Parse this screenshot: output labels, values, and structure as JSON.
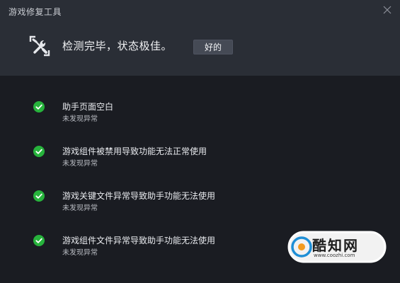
{
  "window": {
    "title": "游戏修复工具"
  },
  "header": {
    "status_text": "检测完毕，状态极佳。",
    "ok_button_label": "好的",
    "icon": "repair-tools-icon"
  },
  "results": [
    {
      "title": "助手页面空白",
      "status": "未发现异常",
      "icon": "check-icon"
    },
    {
      "title": "游戏组件被禁用导致功能无法正常使用",
      "status": "未发现异常",
      "icon": "check-icon"
    },
    {
      "title": "游戏关键文件异常导致助手功能无法使用",
      "status": "未发现异常",
      "icon": "check-icon"
    },
    {
      "title": "游戏组件文件异常导致助手功能无法使用",
      "status": "未发现异常",
      "icon": "check-icon"
    }
  ],
  "watermark": {
    "name": "酷知网",
    "url": "www.coozhi.com"
  },
  "colors": {
    "header_bg": "#2a2e36",
    "body_bg": "#1a1c22",
    "check_green": "#27b33c",
    "button_bg": "#454a55"
  }
}
